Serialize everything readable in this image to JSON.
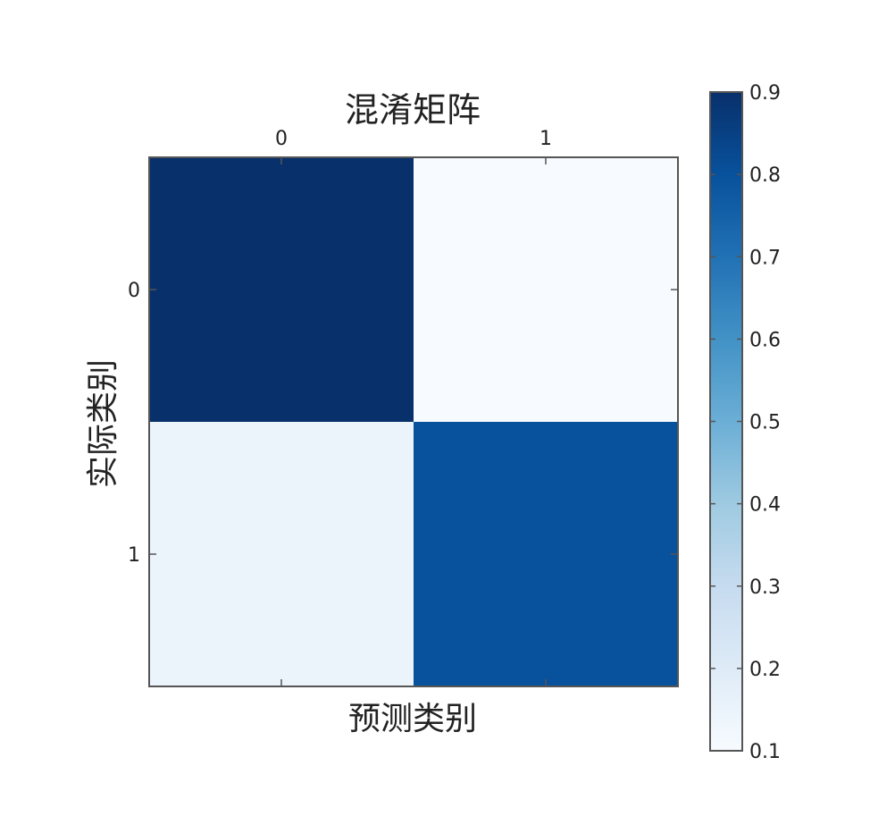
{
  "chart_data": {
    "type": "heatmap",
    "title": "混淆矩阵",
    "xlabel": "预测类别",
    "ylabel": "实际类别",
    "x_categories": [
      "0",
      "1"
    ],
    "y_categories": [
      "0",
      "1"
    ],
    "values": [
      [
        0.9,
        0.1
      ],
      [
        0.15,
        0.8
      ]
    ],
    "colormap": "Blues",
    "colorbar": {
      "min": 0.1,
      "max": 0.9,
      "ticks": [
        "0.1",
        "0.2",
        "0.3",
        "0.4",
        "0.5",
        "0.6",
        "0.7",
        "0.8",
        "0.9"
      ]
    },
    "x_ticks_position": "top",
    "grid": false
  }
}
